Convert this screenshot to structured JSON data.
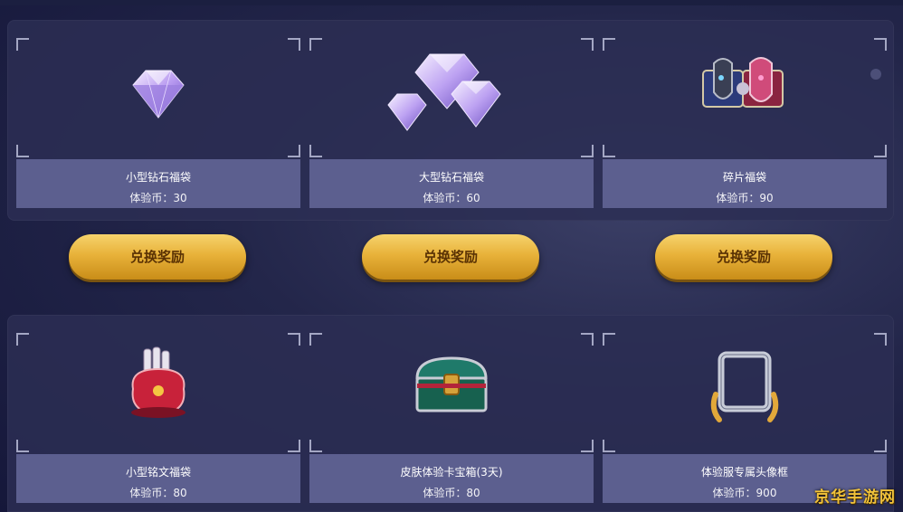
{
  "rewards_top": [
    {
      "name": "小型钻石福袋",
      "price": "体验币：30",
      "icon": "diamond-icon"
    },
    {
      "name": "大型钻石福袋",
      "price": "体验币：60",
      "icon": "diamonds-cluster-icon"
    },
    {
      "name": "碎片福袋",
      "price": "体验币：90",
      "icon": "puzzle-fragments-icon"
    }
  ],
  "buttons": [
    "兑换奖励",
    "兑换奖励",
    "兑换奖励"
  ],
  "rewards_bottom": [
    {
      "name": "小型铭文福袋",
      "price": "体验币：80",
      "icon": "inscription-bag-icon"
    },
    {
      "name": "皮肤体验卡宝箱(3天)",
      "price": "体验币：80",
      "icon": "treasure-chest-icon"
    },
    {
      "name": "体验服专属头像框",
      "price": "体验币：900",
      "icon": "avatar-frame-icon"
    }
  ],
  "watermark": "京华手游网",
  "colors": {
    "button_gold": "#e8b23a",
    "button_text": "#5a3204",
    "info_bar": "#5c5f8f",
    "panel": "#2c2e54"
  }
}
